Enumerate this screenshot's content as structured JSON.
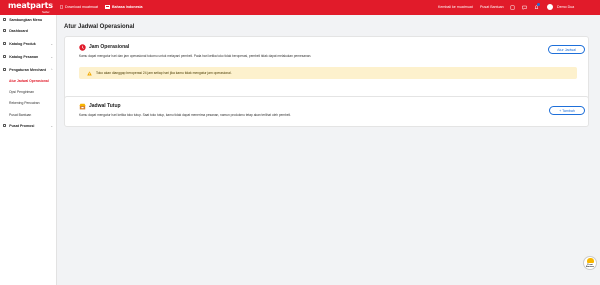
{
  "topbar": {
    "logo_text": "meatparts",
    "logo_sub": "Seller",
    "download_label": "Download muatmuat",
    "language_label": "Bahasa Indonesia",
    "link_kembali": "Kembali ke muatmuat",
    "link_pusat_bantuan": "Pusat Bantuan",
    "user_name": "Demo Dua",
    "accent_color": "#e11b2a"
  },
  "sidebar": {
    "items": [
      {
        "label": "Sambungkan Menu"
      },
      {
        "label": "Dashboard"
      },
      {
        "label": "Katalog Produk"
      },
      {
        "label": "Katalog Pesanan"
      },
      {
        "label": "Pengaturan Merchant"
      }
    ],
    "subitems": [
      {
        "label": "Atur Jadwal Operasional",
        "active": true
      },
      {
        "label": "Opsi Pengiriman",
        "active": false
      },
      {
        "label": "Rekening Pencairan",
        "active": false
      },
      {
        "label": "Pusat Bantuan",
        "active": false
      }
    ],
    "promo_label": "Pusat Promosi"
  },
  "main": {
    "page_title": "Atur Jadwal Operasional",
    "jam": {
      "title": "Jam Operasional",
      "desc": "Kamu dapat mengatur hari dan jam operasional tokomu untuk melayani pembeli. Pada hari ketika toko tidak beroperasi, pembeli tidak dapat melakukan pemesanan.",
      "button": "Atur Jadwal",
      "notice": "Toko akan dianggap beroperasi 24 jam setiap hari jika kamu tidak mengatur jam operasional."
    },
    "tutup": {
      "title": "Jadwal Tutup",
      "desc": "Kamu dapat mengatur hari ketika toko tutup. Saat toko tutup, kamu tidak dapat menerima pesanan, namun produkmu tetap akan terlihat oleh pembeli.",
      "button": "+ Tambah"
    }
  },
  "help": {
    "label": "Pusat Bantuan"
  }
}
